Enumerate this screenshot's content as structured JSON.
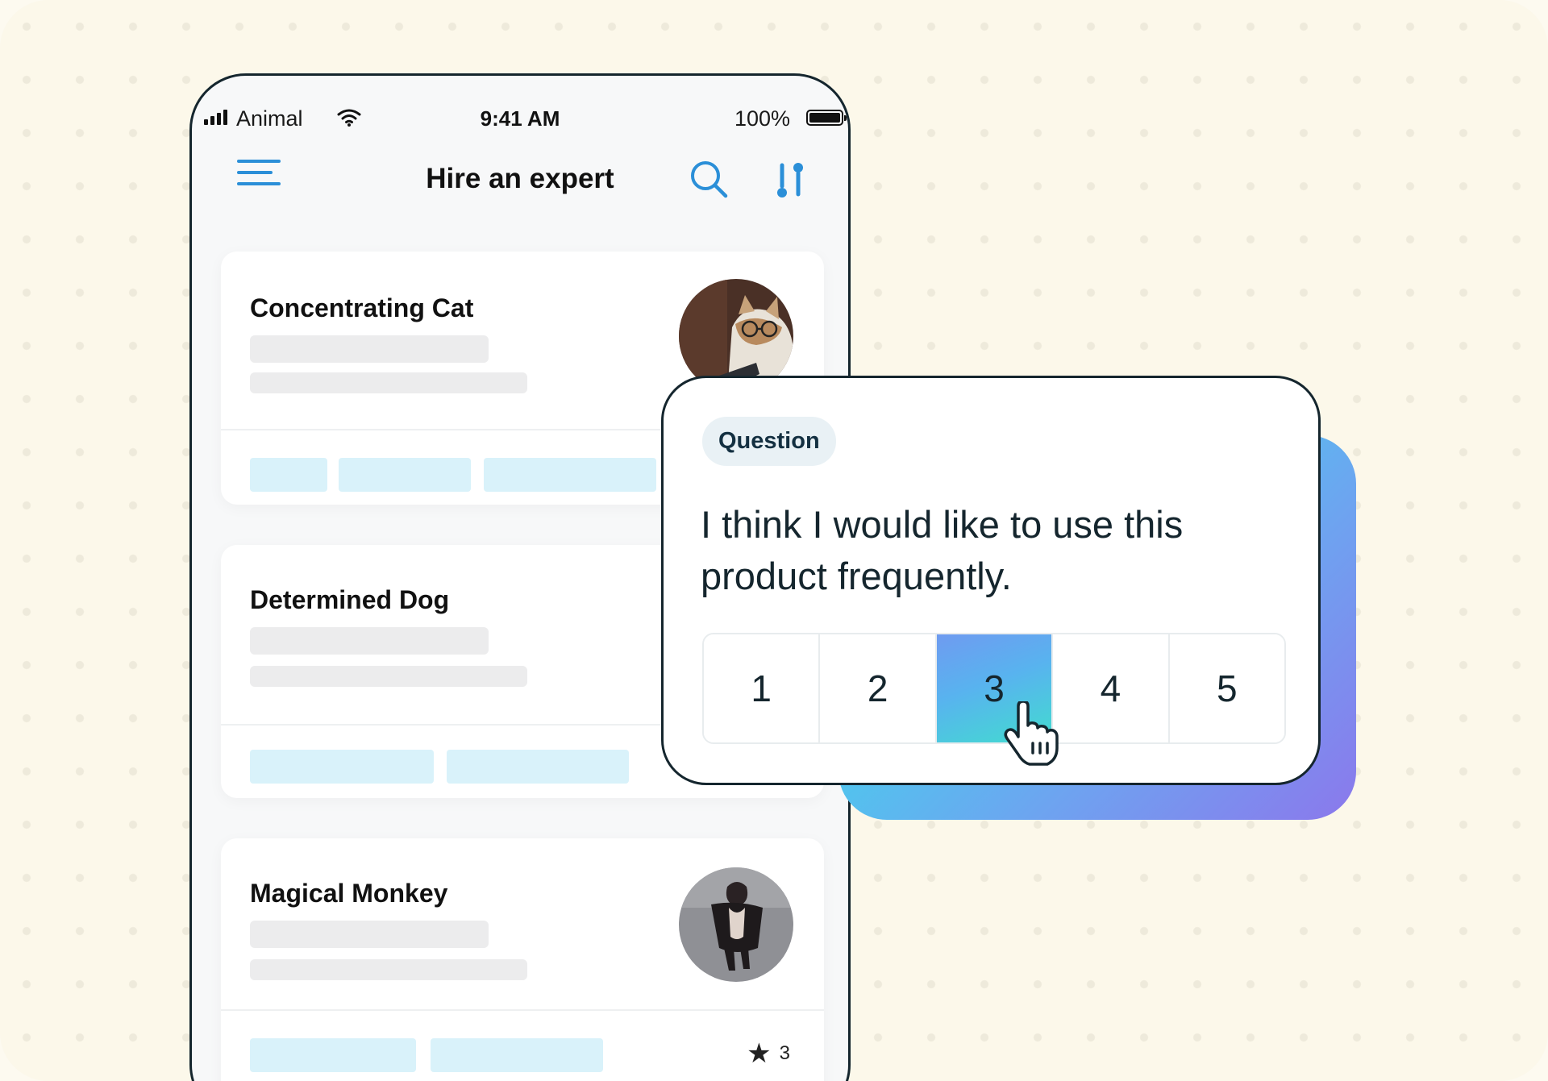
{
  "status_bar": {
    "carrier": "Animal",
    "time": "9:41 AM",
    "battery": "100%"
  },
  "nav": {
    "title": "Hire an expert",
    "menu_icon": "hamburger-menu-icon",
    "search_icon": "search-icon",
    "sort_icon": "sort-filter-icon"
  },
  "experts": [
    {
      "name": "Concentrating Cat",
      "avatar": "cat-with-glasses-photo"
    },
    {
      "name": "Determined Dog"
    },
    {
      "name": "Magical Monkey",
      "avatar": "monkey-photo",
      "rating": "3"
    }
  ],
  "question_card": {
    "badge": "Question",
    "text": "I think I would like to use this product frequently.",
    "options": [
      "1",
      "2",
      "3",
      "4",
      "5"
    ],
    "selected": "3"
  },
  "colors": {
    "accent": "#2b8fd8",
    "chip": "#d9f2fa",
    "card_border": "#15262e"
  }
}
